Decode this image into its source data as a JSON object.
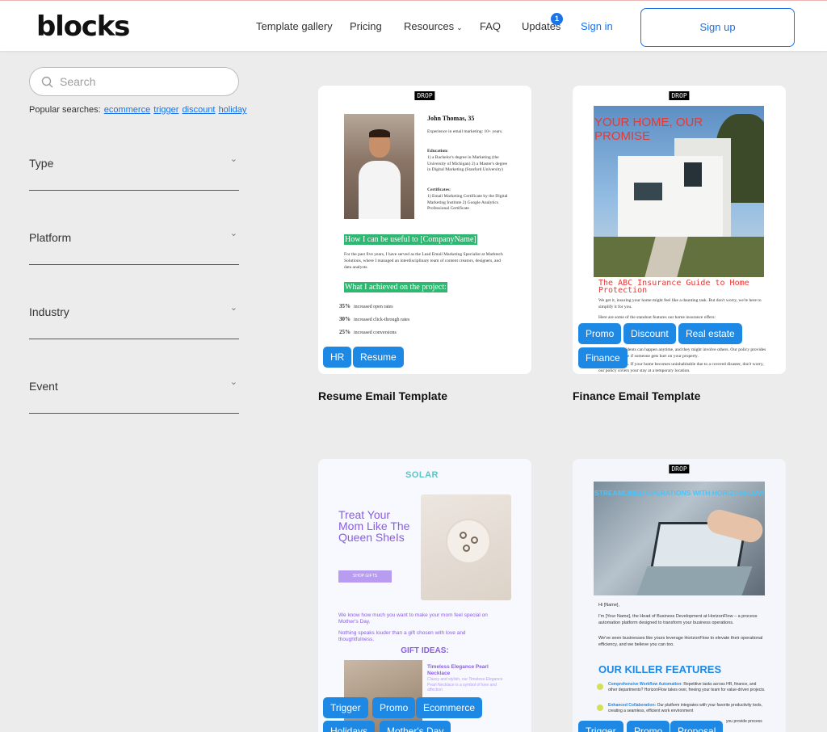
{
  "header": {
    "logo": "blocks",
    "nav": [
      {
        "label": "Template gallery"
      },
      {
        "label": "Pricing"
      },
      {
        "label": "Resources"
      },
      {
        "label": "FAQ"
      },
      {
        "label": "Updates",
        "badge": "1"
      },
      {
        "label": "Sign in"
      }
    ],
    "signup_label": "Sign up"
  },
  "sidebar": {
    "search_placeholder": "Search",
    "popular_label": "Popular searches:",
    "popular": [
      "ecommerce",
      "trigger",
      "discount",
      "holiday"
    ],
    "filters": [
      "Type",
      "Platform",
      "Industry",
      "Event"
    ]
  },
  "cards": [
    {
      "title": "Resume Email Template",
      "tags": [
        "HR",
        "Resume"
      ],
      "preview": {
        "drop": "DROP",
        "name": "John Thomas, 35",
        "experience": "Experience in email marketing: 10+ years.",
        "education_label": "Education:",
        "education": "1) a Bachelor's degree in Marketing (the University of Michigan) 2) a Master's degree in Digital Marketing (Stanford University)",
        "certificates_label": "Certificates:",
        "certificates": "1) Email Marketing Certificate by the Digital Marketing Institute 2) Google Analytics Professional Certificate",
        "heading1": "How I can be useful to [CompanyName]",
        "para1": "For the past five years, I have served as the Lead Email Marketing Specialist at Marktech Solutions, where I managed an interdisciplinary team of content creators, designers, and data analysts.",
        "heading2": "What I achieved on the project:",
        "stats": [
          {
            "value": "35%",
            "label": "increased open rates"
          },
          {
            "value": "30%",
            "label": "increased click-through rates"
          },
          {
            "value": "25%",
            "label": "increased conversions"
          }
        ]
      }
    },
    {
      "title": "Finance Email Template",
      "tags": [
        "Promo",
        "Discount",
        "Real estate",
        "Finance"
      ],
      "preview": {
        "drop": "DROP",
        "hero_title": "YOUR HOME, OUR PROMISE",
        "guide_title": "The ABC Insurance Guide to Home Protection",
        "para1": "We get it, insuring your home might feel like a daunting task. But don't worry, we're here to simplify it for you.",
        "para2": "Here are some of the standout features our home insurance offers:",
        "para3": "protection. Accidents can happen anytime, and they might involve others. Our policy provides liability coverage if someone gets hurt on your property.",
        "para4": "Living Expenses. If your home becomes uninhabitable due to a covered disaster, don't worry, our policy covers your stay at a temporary location."
      }
    },
    {
      "title": "",
      "tags": [
        "Trigger",
        "Promo",
        "Ecommerce",
        "Holidays",
        "Mother's Day"
      ],
      "preview": {
        "logo": "SOLAR",
        "headline": "Treat Your Mom Like The Queen SheIs",
        "button": "SHOP GIFTS",
        "text1": "We know how much you want to make your mom feel special on Mother's Day.",
        "text2": "Nothing speaks louder than a gift chosen with love and thoughtfulness.",
        "gift_ideas": "GIFT IDEAS:",
        "gift_title": "Timeless Elegance Pearl Necklace",
        "gift_desc": "Classy and stylish, our Timeless Elegance Pearl Necklace is a symbol of love and affection"
      }
    },
    {
      "title": "",
      "tags": [
        "Trigger",
        "Promo",
        "Proposal"
      ],
      "preview": {
        "drop": "DROP",
        "hero_title": "STREAMLINED OPERATIONS WITH HORIZONFLOW",
        "greeting": "Hi [Name],",
        "para1": "I'm [Your Name], the Head of Business Development at HorizonFlow – a process automation platform designed to transform your business operations.",
        "para2": "We've seen businesses like yours leverage HorizonFlow to elevate their operational efficiency, and we believe you can too.",
        "features_title": "OUR KILLER FEATURES",
        "feature1_title": "Comprehensive Workflow Automation:",
        "feature1": "Repetitive tasks across HR, finance, and other departments? HorizonFlow takes over, freeing your team for value-driven projects.",
        "feature2_title": "Enhanced Collaboration:",
        "feature2": "Our platform integrates with your favorite productivity tools, creating a seamless, efficient work environment",
        "feature3": "you provide process"
      }
    }
  ]
}
